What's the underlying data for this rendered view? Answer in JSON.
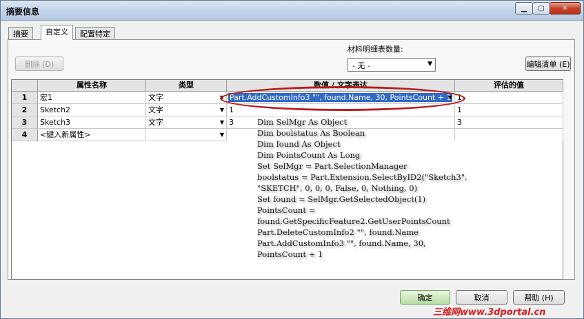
{
  "window": {
    "title": "摘要信息"
  },
  "tabs": [
    {
      "label": "摘要"
    },
    {
      "label": "自定义"
    },
    {
      "label": "配置特定"
    }
  ],
  "toolbar": {
    "delete_label": "删除 (D)",
    "bom_qty_label": "材料明细表数量:",
    "bom_qty_value": "- 无 -",
    "edit_list_label": "编辑清单 (E)"
  },
  "grid": {
    "headers": [
      "属性名称",
      "类型",
      "数值 / 文字表达",
      "评估的值"
    ],
    "rows": [
      {
        "num": "1",
        "name": "宏1",
        "type": "文字",
        "value": "Part.AddCustomInfo3 \"\", found.Name, 30, PointsCount + 1",
        "evaluated": "1"
      },
      {
        "num": "2",
        "name": "Sketch2",
        "type": "文字",
        "value": "1",
        "evaluated": "1"
      },
      {
        "num": "3",
        "name": "Sketch3",
        "type": "文字",
        "value": "3",
        "evaluated": "3"
      },
      {
        "num": "4",
        "name": "<键入新属性>",
        "type": "",
        "value": "",
        "evaluated": ""
      }
    ]
  },
  "code_lines": [
    "Dim SelMgr As Object",
    "Dim boolstatus As Boolean",
    "Dim found As Object",
    "Dim PointsCount As Long",
    "Set SelMgr = Part.SelectionManager",
    "boolstatus = Part.Extension.SelectByID2(\"Sketch3\",",
    "\"SKETCH\", 0, 0, 0, False, 0, Nothing, 0)",
    "Set found = SelMgr.GetSelectedObject(1)",
    "PointsCount =",
    "found.GetSpecificFeature2.GetUserPointsCount",
    "Part.DeleteCustomInfo2 \"\", found.Name",
    "Part.AddCustomInfo3 \"\", found.Name, 30,",
    "PointsCount + 1"
  ],
  "footer": {
    "ok_label": "确定",
    "cancel_label": "取消",
    "help_label": "帮助 (H)"
  },
  "watermark": "三维网www.3dportal.cn",
  "colors": {
    "highlight_ring": "#b81e1e",
    "selection": "#316ac5"
  }
}
